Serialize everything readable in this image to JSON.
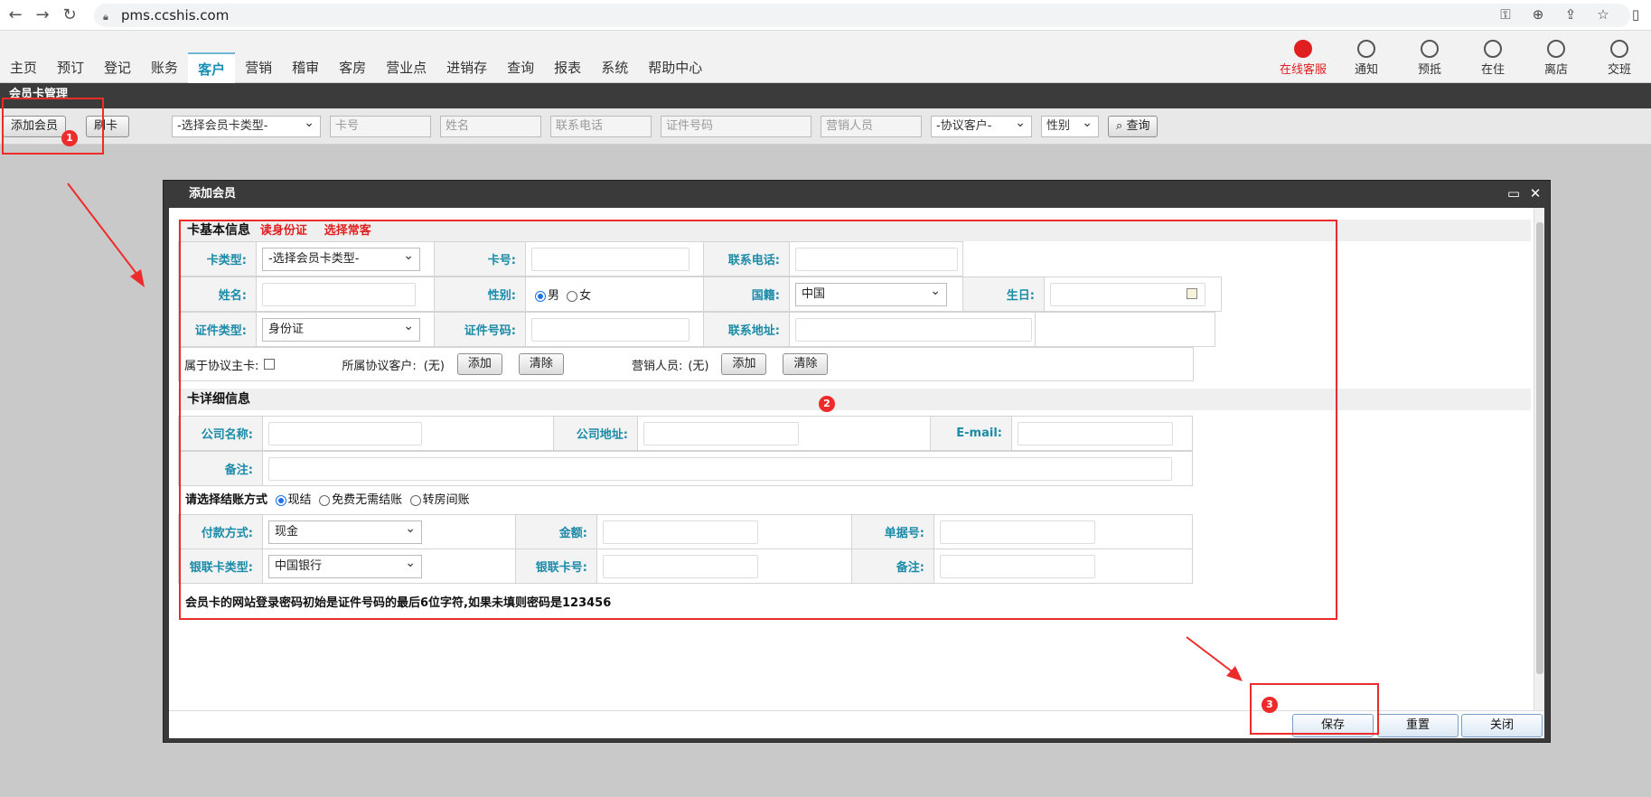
{
  "browser": {
    "url": "pms.ccshis.com"
  },
  "menu": {
    "items": [
      "主页",
      "预订",
      "登记",
      "账务",
      "客户",
      "营销",
      "稽审",
      "客房",
      "营业点",
      "进销存",
      "查询",
      "报表",
      "系统",
      "帮助中心"
    ],
    "active_index": 4,
    "right": [
      {
        "label": "在线客服",
        "icon": "support-icon"
      },
      {
        "label": "通知",
        "icon": "notice-icon"
      },
      {
        "label": "预抵",
        "icon": "clock-icon"
      },
      {
        "label": "在住",
        "icon": "bed-icon"
      },
      {
        "label": "离店",
        "icon": "logout-icon"
      },
      {
        "label": "交班",
        "icon": "shift-icon"
      }
    ]
  },
  "module": {
    "title": "会员卡管理"
  },
  "toolbar": {
    "add_member": "添加会员",
    "swipe": "刷卡",
    "card_type": "-选择会员卡类型-",
    "card_no_ph": "卡号",
    "name_ph": "姓名",
    "phone_ph": "联系电话",
    "id_no_ph": "证件号码",
    "sales_ph": "营销人员",
    "agreement": "-协议客户-",
    "gender": "性别",
    "query": "查询"
  },
  "annotations": {
    "b1": "1",
    "b2": "2",
    "b3": "3"
  },
  "dialog": {
    "title": "添加会员",
    "basic": {
      "heading": "卡基本信息",
      "read_id": "读身份证",
      "choose_guest": "选择常客",
      "card_type_label": "卡类型:",
      "card_type_value": "-选择会员卡类型-",
      "card_no_label": "卡号:",
      "phone_label": "联系电话:",
      "name_label": "姓名:",
      "gender_label": "性别:",
      "male": "男",
      "female": "女",
      "nationality_label": "国籍:",
      "nationality_value": "中国",
      "birthday_label": "生日:",
      "id_type_label": "证件类型:",
      "id_type_value": "身份证",
      "id_no_label": "证件号码:",
      "address_label": "联系地址:",
      "main_card_label": "属于协议主卡:",
      "agreement_label": "所属协议客户:",
      "none1": "(无)",
      "add1": "添加",
      "clear1": "清除",
      "sales_label": "营销人员:",
      "none2": "(无)",
      "add2": "添加",
      "clear2": "清除"
    },
    "detail": {
      "heading": "卡详细信息",
      "company_label": "公司名称:",
      "company_addr_label": "公司地址:",
      "email_label": "E-mail:",
      "remark_label": "备注:"
    },
    "settle": {
      "label": "请选择结账方式",
      "opt1": "现结",
      "opt2": "免费无需结账",
      "opt3": "转房间账",
      "pay_method_label": "付款方式:",
      "pay_method_value": "现金",
      "amount_label": "金额:",
      "receipt_label": "单据号:",
      "bank_type_label": "银联卡类型:",
      "bank_type_value": "中国银行",
      "bank_no_label": "银联卡号:",
      "remark_label": "备注:"
    },
    "note": "会员卡的网站登录密码初始是证件号码的最后6位字符,如果未填则密码是123456",
    "save": "保存",
    "reset": "重置",
    "close": "关闭"
  }
}
